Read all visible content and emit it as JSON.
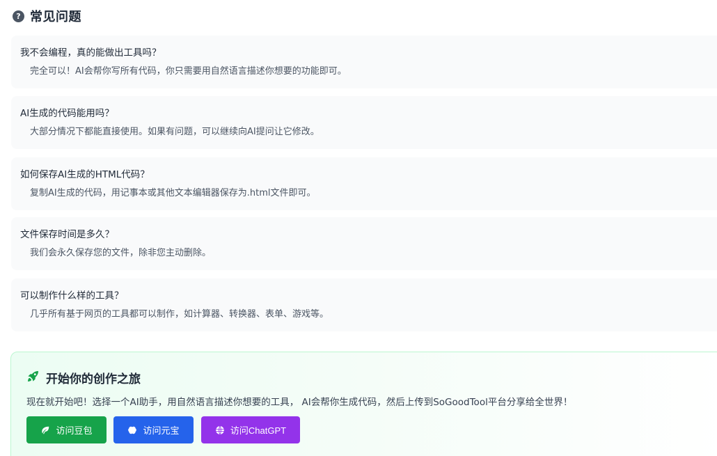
{
  "faq": {
    "title": "常见问题",
    "items": [
      {
        "question": "我不会编程，真的能做出工具吗？",
        "answer": "完全可以！AI会帮你写所有代码，你只需要用自然语言描述你想要的功能即可。"
      },
      {
        "question": "AI生成的代码能用吗？",
        "answer": "大部分情况下都能直接使用。如果有问题，可以继续向AI提问让它修改。"
      },
      {
        "question": "如何保存AI生成的HTML代码？",
        "answer": "复制AI生成的代码，用记事本或其他文本编辑器保存为.html文件即可。"
      },
      {
        "question": "文件保存时间是多久？",
        "answer": "我们会永久保存您的文件，除非您主动删除。"
      },
      {
        "question": "可以制作什么样的工具？",
        "answer": "几乎所有基于网页的工具都可以制作，如计算器、转换器、表单、游戏等。"
      }
    ]
  },
  "cta": {
    "title": "开始你的创作之旅",
    "text": "现在就开始吧！选择一个AI助手，用自然语言描述你想要的工具， AI会帮你生成代码，然后上传到SoGoodTool平台分享给全世界！",
    "buttons": {
      "doubao": "访问豆包",
      "yuanbao": "访问元宝",
      "chatgpt": "访问ChatGPT"
    }
  },
  "colors": {
    "green": "#16a34a",
    "blue": "#2563eb",
    "purple": "#9333ea",
    "card_bg": "#f9fafb"
  },
  "icons": {
    "faq": "question-circle-icon",
    "cta": "rocket-icon",
    "doubao": "leaf-icon",
    "yuanbao": "brain-icon",
    "chatgpt": "globe-icon"
  }
}
